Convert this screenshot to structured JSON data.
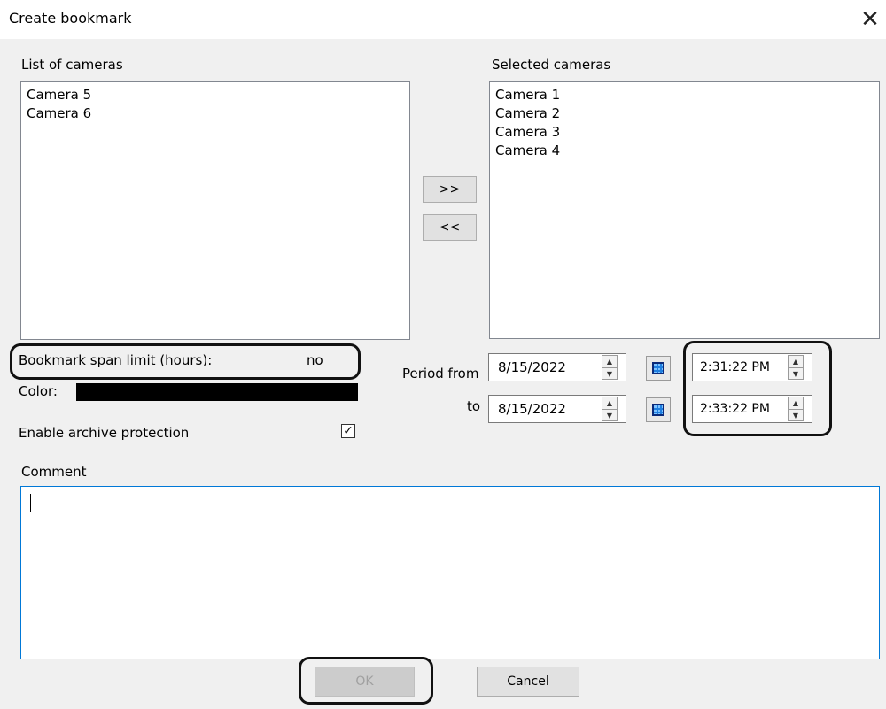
{
  "window": {
    "title": "Create bookmark",
    "close_glyph": "✕"
  },
  "available": {
    "label": "List of cameras",
    "items": [
      "Camera 5",
      "Camera 6"
    ]
  },
  "selected": {
    "label": "Selected cameras",
    "items": [
      "Camera 1",
      "Camera 2",
      "Camera 3",
      "Camera 4"
    ]
  },
  "transfer": {
    "add_label": ">>",
    "remove_label": "<<"
  },
  "span_limit": {
    "label": "Bookmark span limit (hours):",
    "value": "no"
  },
  "color": {
    "label": "Color:",
    "value": "#000000"
  },
  "archive_protection": {
    "label": "Enable archive protection",
    "checked": true,
    "check_glyph": "✓"
  },
  "period": {
    "from_label": "Period from",
    "to_label": "to",
    "from_date": "8/15/2022",
    "to_date": "8/15/2022",
    "from_time": "2:31:22 PM",
    "to_time": "2:33:22 PM"
  },
  "comment": {
    "label": "Comment",
    "value": ""
  },
  "footer": {
    "ok_label": "OK",
    "cancel_label": "Cancel"
  }
}
